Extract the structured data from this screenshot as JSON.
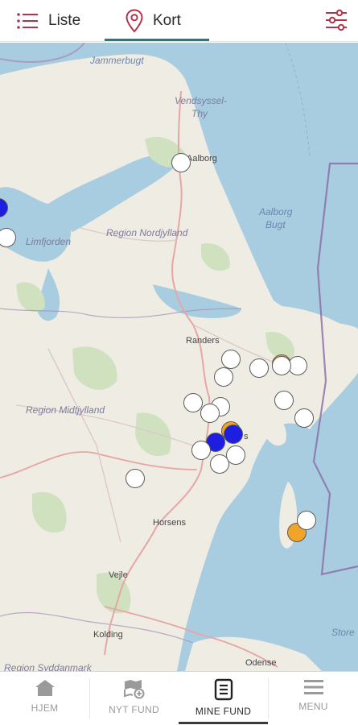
{
  "topbar": {
    "tabs": [
      {
        "label": "Liste",
        "icon": "list-icon"
      },
      {
        "label": "Kort",
        "icon": "map-pin-icon"
      }
    ],
    "active_tab": "Kort",
    "filter_icon": "filter-sliders-icon",
    "accent_color": "#b3344a",
    "underline_color": "#3f6f78"
  },
  "map": {
    "sea_labels": {
      "jammerbugt": "Jammerbugt",
      "aalborg_bugt_1": "Aalborg",
      "aalborg_bugt_2": "Bugt",
      "storebaelt": "Store"
    },
    "region_labels": {
      "vendsyssel_1": "Vendsyssel-",
      "vendsyssel_2": "Thy",
      "limfjorden": "Limfjorden",
      "nordjylland": "Region Nordjylland",
      "midtjylland": "Region Midtjylland",
      "syddanmark": "Region Syddanmark"
    },
    "city_labels": {
      "aalborg": "Aalborg",
      "randers": "Randers",
      "aarhus": "s",
      "horsens": "Horsens",
      "vejle": "Vejle",
      "kolding": "Kolding",
      "odense": "Odense"
    },
    "marker_colors": {
      "white": "#ffffff",
      "orange": "#f1a42a",
      "blue": "#1e1ee0"
    },
    "find_markers": [
      {
        "color": "white"
      },
      {
        "color": "white"
      },
      {
        "color": "blue"
      },
      {
        "color": "white"
      },
      {
        "color": "white"
      },
      {
        "color": "orange"
      },
      {
        "color": "white"
      },
      {
        "color": "white"
      },
      {
        "color": "white"
      },
      {
        "color": "white"
      },
      {
        "color": "white"
      },
      {
        "color": "white"
      },
      {
        "color": "white"
      },
      {
        "color": "white"
      },
      {
        "color": "orange"
      },
      {
        "color": "blue"
      },
      {
        "color": "blue"
      },
      {
        "color": "white"
      },
      {
        "color": "white"
      },
      {
        "color": "white"
      },
      {
        "color": "white"
      },
      {
        "color": "orange"
      },
      {
        "color": "white"
      }
    ]
  },
  "bottomnav": {
    "items": [
      {
        "label": "HJEM",
        "icon": "home-icon"
      },
      {
        "label": "NYT FUND",
        "icon": "new-find-icon"
      },
      {
        "label": "MINE FUND",
        "icon": "document-list-icon"
      },
      {
        "label": "MENU",
        "icon": "hamburger-menu-icon"
      }
    ],
    "active": "MINE FUND"
  }
}
